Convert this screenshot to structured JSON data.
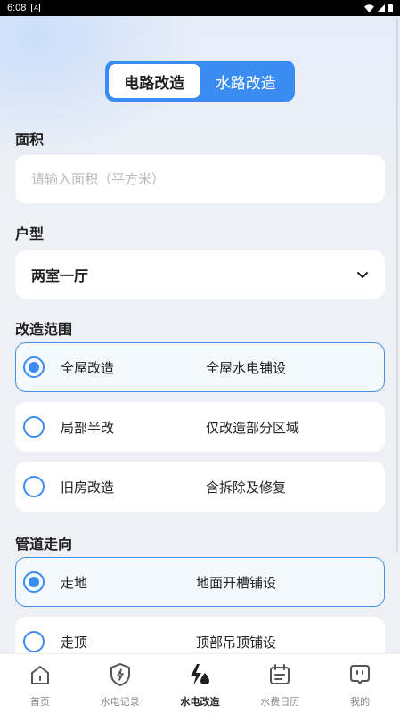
{
  "status_bar": {
    "time": "6:08"
  },
  "segment": {
    "tabs": [
      {
        "label": "电路改造",
        "active": true
      },
      {
        "label": "水路改造",
        "active": false
      }
    ]
  },
  "area": {
    "label": "面积",
    "placeholder": "请输入面积（平方米）",
    "value": ""
  },
  "house_type": {
    "label": "户型",
    "selected": "两室一厅"
  },
  "scope": {
    "label": "改造范围",
    "options": [
      {
        "name": "全屋改造",
        "desc": "全屋水电铺设",
        "selected": true
      },
      {
        "name": "局部半改",
        "desc": "仅改造部分区域",
        "selected": false
      },
      {
        "name": "旧房改造",
        "desc": "含拆除及修复",
        "selected": false
      }
    ]
  },
  "pipe": {
    "label": "管道走向",
    "options": [
      {
        "name": "走地",
        "desc": "地面开槽铺设",
        "selected": true
      },
      {
        "name": "走顶",
        "desc": "顶部吊顶铺设",
        "selected": false
      }
    ]
  },
  "tabbar": {
    "items": [
      {
        "label": "首页",
        "icon": "home-icon",
        "active": false
      },
      {
        "label": "水电记录",
        "icon": "bolt-shield-icon",
        "active": false
      },
      {
        "label": "水电改造",
        "icon": "bolt-drop-icon",
        "active": true
      },
      {
        "label": "水费日历",
        "icon": "calendar-icon",
        "active": false
      },
      {
        "label": "我的",
        "icon": "profile-icon",
        "active": false
      }
    ]
  },
  "colors": {
    "accent": "#3b8cf2",
    "background": "#eef0f5"
  }
}
